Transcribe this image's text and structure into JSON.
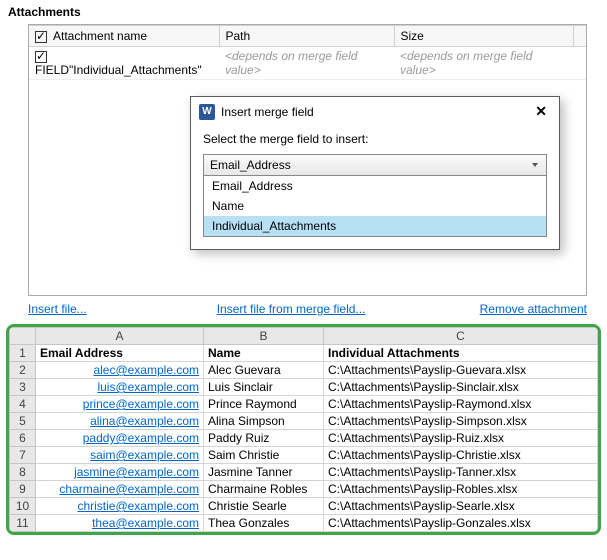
{
  "section": {
    "title": "Attachments"
  },
  "columns": {
    "name": "Attachment name",
    "path": "Path",
    "size": "Size"
  },
  "row1": {
    "name": "FIELD\"Individual_Attachments\"",
    "path": "<depends on merge field value>",
    "size": "<depends on merge field value>"
  },
  "dialog": {
    "title": "Insert merge field",
    "label": "Select the merge field to insert:",
    "selected": "Email_Address",
    "options": [
      "Email_Address",
      "Name",
      "Individual_Attachments"
    ]
  },
  "links": {
    "insert": "Insert file...",
    "insertMerge": "Insert file from merge field...",
    "remove": "Remove attachment"
  },
  "sheet": {
    "colLetters": [
      "A",
      "B",
      "C"
    ],
    "headers": [
      "Email Address",
      "Name",
      "Individual Attachments"
    ],
    "rows": [
      {
        "n": "2",
        "email": "alec@example.com",
        "name": "Alec Guevara",
        "path": "C:\\Attachments\\Payslip-Guevara.xlsx"
      },
      {
        "n": "3",
        "email": "luis@example.com",
        "name": "Luis Sinclair",
        "path": "C:\\Attachments\\Payslip-Sinclair.xlsx"
      },
      {
        "n": "4",
        "email": "prince@example.com",
        "name": "Prince Raymond",
        "path": "C:\\Attachments\\Payslip-Raymond.xlsx"
      },
      {
        "n": "5",
        "email": "alina@example.com",
        "name": "Alina Simpson",
        "path": "C:\\Attachments\\Payslip-Simpson.xlsx"
      },
      {
        "n": "6",
        "email": "paddy@example.com",
        "name": "Paddy Ruiz",
        "path": "C:\\Attachments\\Payslip-Ruiz.xlsx"
      },
      {
        "n": "7",
        "email": "saim@example.com",
        "name": "Saim Christie",
        "path": "C:\\Attachments\\Payslip-Christie.xlsx"
      },
      {
        "n": "8",
        "email": "jasmine@example.com",
        "name": "Jasmine Tanner",
        "path": "C:\\Attachments\\Payslip-Tanner.xlsx"
      },
      {
        "n": "9",
        "email": "charmaine@example.com",
        "name": "Charmaine Robles",
        "path": "C:\\Attachments\\Payslip-Robles.xlsx"
      },
      {
        "n": "10",
        "email": "christie@example.com",
        "name": "Christie Searle",
        "path": "C:\\Attachments\\Payslip-Searle.xlsx"
      },
      {
        "n": "11",
        "email": "thea@example.com",
        "name": "Thea Gonzales",
        "path": "C:\\Attachments\\Payslip-Gonzales.xlsx"
      }
    ]
  }
}
